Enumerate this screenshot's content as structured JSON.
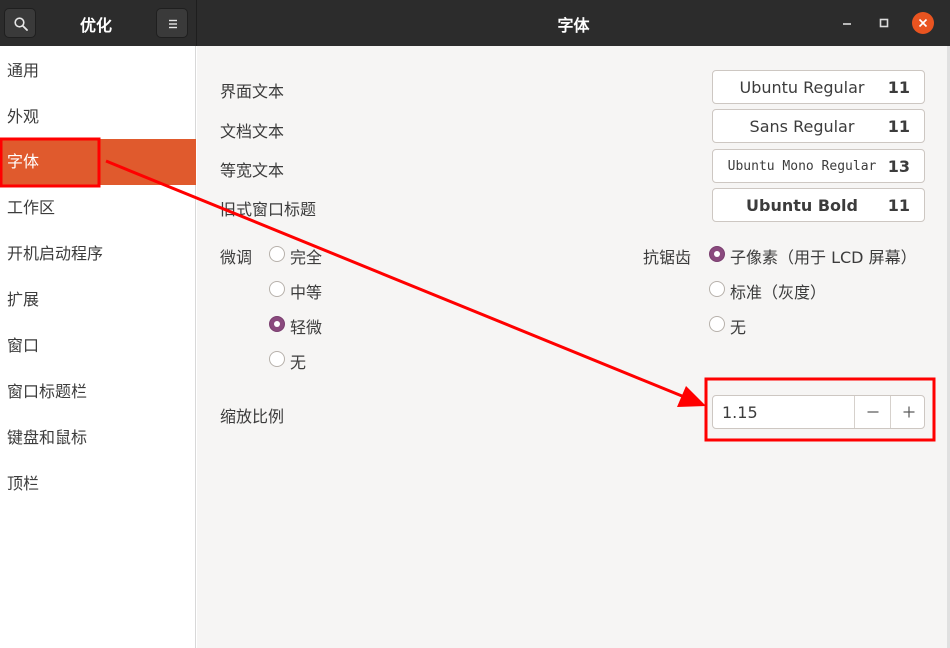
{
  "header": {
    "app_title": "优化",
    "page_title": "字体",
    "search_icon": "search-icon",
    "menu_icon": "hamburger-menu-icon"
  },
  "sidebar": {
    "items": [
      {
        "label": "通用"
      },
      {
        "label": "外观"
      },
      {
        "label": "字体",
        "active": true
      },
      {
        "label": "工作区"
      },
      {
        "label": "开机启动程序"
      },
      {
        "label": "扩展"
      },
      {
        "label": "窗口"
      },
      {
        "label": "窗口标题栏"
      },
      {
        "label": "键盘和鼠标"
      },
      {
        "label": "顶栏"
      }
    ]
  },
  "fonts": {
    "interface": {
      "label": "界面文本",
      "font": "Ubuntu Regular",
      "size": "11"
    },
    "document": {
      "label": "文档文本",
      "font": "Sans Regular",
      "size": "11"
    },
    "monospace": {
      "label": "等宽文本",
      "font": "Ubuntu Mono Regular",
      "size": "13"
    },
    "legacy_title": {
      "label": "旧式窗口标题",
      "font": "Ubuntu Bold",
      "size": "11"
    }
  },
  "hinting": {
    "label": "微调",
    "options": [
      "完全",
      "中等",
      "轻微",
      "无"
    ],
    "selected": "轻微"
  },
  "antialiasing": {
    "label": "抗锯齿",
    "options": [
      "子像素（用于 LCD 屏幕）",
      "标准（灰度）",
      "无"
    ],
    "selected": "子像素（用于 LCD 屏幕）"
  },
  "scaling": {
    "label": "缩放比例",
    "value": "1.15"
  },
  "colors": {
    "accent": "#e95420",
    "sidebar_active": "#e05a2d",
    "radio_checked": "#8a4a7e",
    "annotation": "#ff0000"
  }
}
